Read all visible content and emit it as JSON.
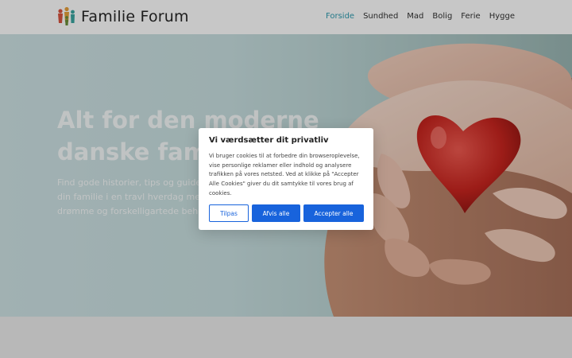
{
  "site": {
    "name": "Familie Forum",
    "logo_icon": "family-logo-icon"
  },
  "nav": {
    "items": [
      {
        "label": "Forside",
        "active": true
      },
      {
        "label": "Sundhed",
        "active": false
      },
      {
        "label": "Mad",
        "active": false
      },
      {
        "label": "Bolig",
        "active": false
      },
      {
        "label": "Ferie",
        "active": false
      },
      {
        "label": "Hygge",
        "active": false
      }
    ]
  },
  "hero": {
    "title_line1": "Alt for den moderne",
    "title_line2": "danske familie",
    "subtitle_line1": "Find gode historier, tips og guides til",
    "subtitle_line2": "din familie i en travl hverdag med",
    "subtitle_line3": "drømme og forskelligartede behov",
    "image": "hands-holding-red-heart"
  },
  "cookie_banner": {
    "title": "Vi værdsætter dit privatliv",
    "body": "Vi bruger cookies til at forbedre din browseroplevelse, vise personlige reklamer eller indhold og analysere trafikken på vores netsted. Ved at klikke på \"Accepter Alle Cookies\" giver du dit samtykke til vores brug af cookies.",
    "customize_label": "Tilpas",
    "reject_label": "Afvis alle",
    "accept_label": "Accepter alle"
  },
  "colors": {
    "accent": "#2e9bb0",
    "button_blue": "#1863dc"
  }
}
